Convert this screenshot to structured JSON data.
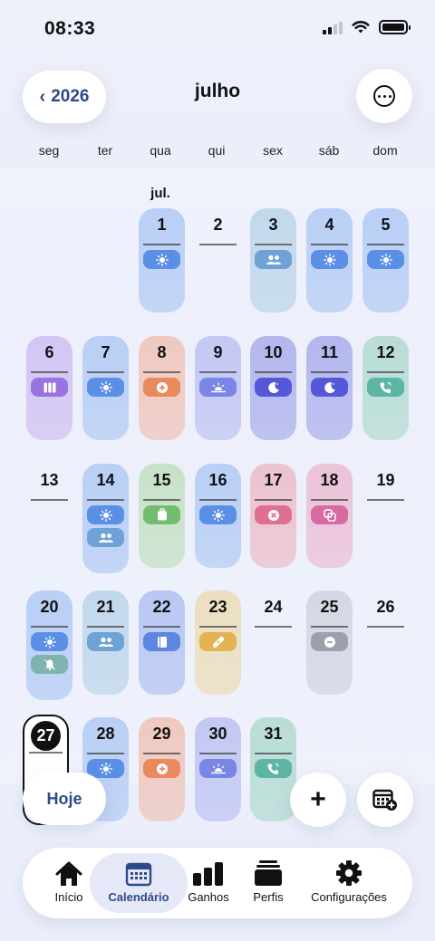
{
  "status": {
    "time": "08:33"
  },
  "header": {
    "year_label": "2026",
    "month_title": "julho"
  },
  "weekdays": [
    "seg",
    "ter",
    "qua",
    "qui",
    "sex",
    "sáb",
    "dom"
  ],
  "month_label": "jul.",
  "days": [
    {
      "day": "1",
      "col": 2,
      "row": 0,
      "bg": "#b9cff5",
      "chips": [
        {
          "icon": "sun-icon",
          "color": "#5b8fe6"
        }
      ]
    },
    {
      "day": "2",
      "col": 3,
      "row": 0,
      "bg": null,
      "chips": []
    },
    {
      "day": "3",
      "col": 4,
      "row": 0,
      "bg": "#c2d8ec",
      "chips": [
        {
          "icon": "people-icon",
          "color": "#6fa3d6"
        }
      ]
    },
    {
      "day": "4",
      "col": 5,
      "row": 0,
      "bg": "#b9cff5",
      "chips": [
        {
          "icon": "sun-icon",
          "color": "#5b8fe6"
        }
      ]
    },
    {
      "day": "5",
      "col": 6,
      "row": 0,
      "bg": "#b9cff5",
      "chips": [
        {
          "icon": "sun-icon",
          "color": "#5b8fe6"
        }
      ]
    },
    {
      "day": "6",
      "col": 0,
      "row": 1,
      "bg": "#d3c6f3",
      "chips": [
        {
          "icon": "columns-icon",
          "color": "#9a73e0"
        }
      ]
    },
    {
      "day": "7",
      "col": 1,
      "row": 1,
      "bg": "#b9cff5",
      "chips": [
        {
          "icon": "sun-icon",
          "color": "#5b8fe6"
        }
      ]
    },
    {
      "day": "8",
      "col": 2,
      "row": 1,
      "bg": "#efc9c0",
      "chips": [
        {
          "icon": "plus-circle-icon",
          "color": "#e88a5e"
        }
      ]
    },
    {
      "day": "9",
      "col": 3,
      "row": 1,
      "bg": "#c3c8f4",
      "chips": [
        {
          "icon": "sunrise-icon",
          "color": "#7a86e6"
        }
      ]
    },
    {
      "day": "10",
      "col": 4,
      "row": 1,
      "bg": "#b3b7ee",
      "chips": [
        {
          "icon": "moon-icon",
          "color": "#5458d8"
        }
      ]
    },
    {
      "day": "11",
      "col": 5,
      "row": 1,
      "bg": "#b3b7ee",
      "chips": [
        {
          "icon": "moon-icon",
          "color": "#5458d8"
        }
      ]
    },
    {
      "day": "12",
      "col": 6,
      "row": 1,
      "bg": "#b9ddd6",
      "chips": [
        {
          "icon": "phone-icon",
          "color": "#5db5a3"
        }
      ]
    },
    {
      "day": "13",
      "col": 0,
      "row": 2,
      "bg": null,
      "chips": []
    },
    {
      "day": "14",
      "col": 1,
      "row": 2,
      "bg": "#b9cff5",
      "chips": [
        {
          "icon": "sun-icon",
          "color": "#5b8fe6"
        },
        {
          "icon": "people-icon",
          "color": "#6fa3d6"
        }
      ]
    },
    {
      "day": "15",
      "col": 2,
      "row": 2,
      "bg": "#c8e2c9",
      "chips": [
        {
          "icon": "luggage-icon",
          "color": "#74bd6e"
        }
      ]
    },
    {
      "day": "16",
      "col": 3,
      "row": 2,
      "bg": "#b9cff5",
      "chips": [
        {
          "icon": "sun-icon",
          "color": "#5b8fe6"
        }
      ]
    },
    {
      "day": "17",
      "col": 4,
      "row": 2,
      "bg": "#ecc3d0",
      "chips": [
        {
          "icon": "x-circle-icon",
          "color": "#e0708f"
        }
      ]
    },
    {
      "day": "18",
      "col": 5,
      "row": 2,
      "bg": "#ecc3d8",
      "chips": [
        {
          "icon": "copy-icon",
          "color": "#d86aa2"
        }
      ]
    },
    {
      "day": "19",
      "col": 6,
      "row": 2,
      "bg": null,
      "chips": []
    },
    {
      "day": "20",
      "col": 0,
      "row": 3,
      "bg": "#b9cff5",
      "chips": [
        {
          "icon": "sun-icon",
          "color": "#5b8fe6"
        },
        {
          "icon": "bell-icon",
          "color": "#7fb3b0"
        }
      ]
    },
    {
      "day": "21",
      "col": 1,
      "row": 3,
      "bg": "#c2d8ec",
      "chips": [
        {
          "icon": "people-icon",
          "color": "#6fa3d6"
        }
      ]
    },
    {
      "day": "22",
      "col": 2,
      "row": 3,
      "bg": "#b8c8f2",
      "chips": [
        {
          "icon": "book-icon",
          "color": "#5d86e0"
        }
      ]
    },
    {
      "day": "23",
      "col": 3,
      "row": 3,
      "bg": "#ebdfbf",
      "chips": [
        {
          "icon": "bandage-icon",
          "color": "#e3b251"
        }
      ]
    },
    {
      "day": "24",
      "col": 4,
      "row": 3,
      "bg": null,
      "chips": []
    },
    {
      "day": "25",
      "col": 5,
      "row": 3,
      "bg": "#d4d8e4",
      "chips": [
        {
          "icon": "minus-circle-icon",
          "color": "#9aa0ae"
        }
      ]
    },
    {
      "day": "26",
      "col": 6,
      "row": 3,
      "bg": null,
      "chips": []
    },
    {
      "day": "28",
      "col": 1,
      "row": 4,
      "bg": "#b9cff5",
      "chips": [
        {
          "icon": "sun-icon",
          "color": "#5b8fe6"
        }
      ]
    },
    {
      "day": "29",
      "col": 2,
      "row": 4,
      "bg": "#efc9c0",
      "chips": [
        {
          "icon": "plus-circle-icon",
          "color": "#e88a5e"
        }
      ]
    },
    {
      "day": "30",
      "col": 3,
      "row": 4,
      "bg": "#c3c8f4",
      "chips": [
        {
          "icon": "sunrise-icon",
          "color": "#7a86e6"
        }
      ]
    },
    {
      "day": "31",
      "col": 4,
      "row": 4,
      "bg": "#b9ddd6",
      "chips": [
        {
          "icon": "phone-icon",
          "color": "#5db5a3"
        }
      ]
    }
  ],
  "today": {
    "day": "27"
  },
  "actions": {
    "hoje_label": "Hoje"
  },
  "tabs": [
    {
      "label": "Início",
      "icon": "home-icon",
      "active": false
    },
    {
      "label": "Calendário",
      "icon": "calendar-icon",
      "active": true
    },
    {
      "label": "Ganhos",
      "icon": "bar-chart-icon",
      "active": false
    },
    {
      "label": "Perfis",
      "icon": "profiles-icon",
      "active": false
    },
    {
      "label": "Configurações",
      "icon": "gear-icon",
      "active": false
    }
  ]
}
